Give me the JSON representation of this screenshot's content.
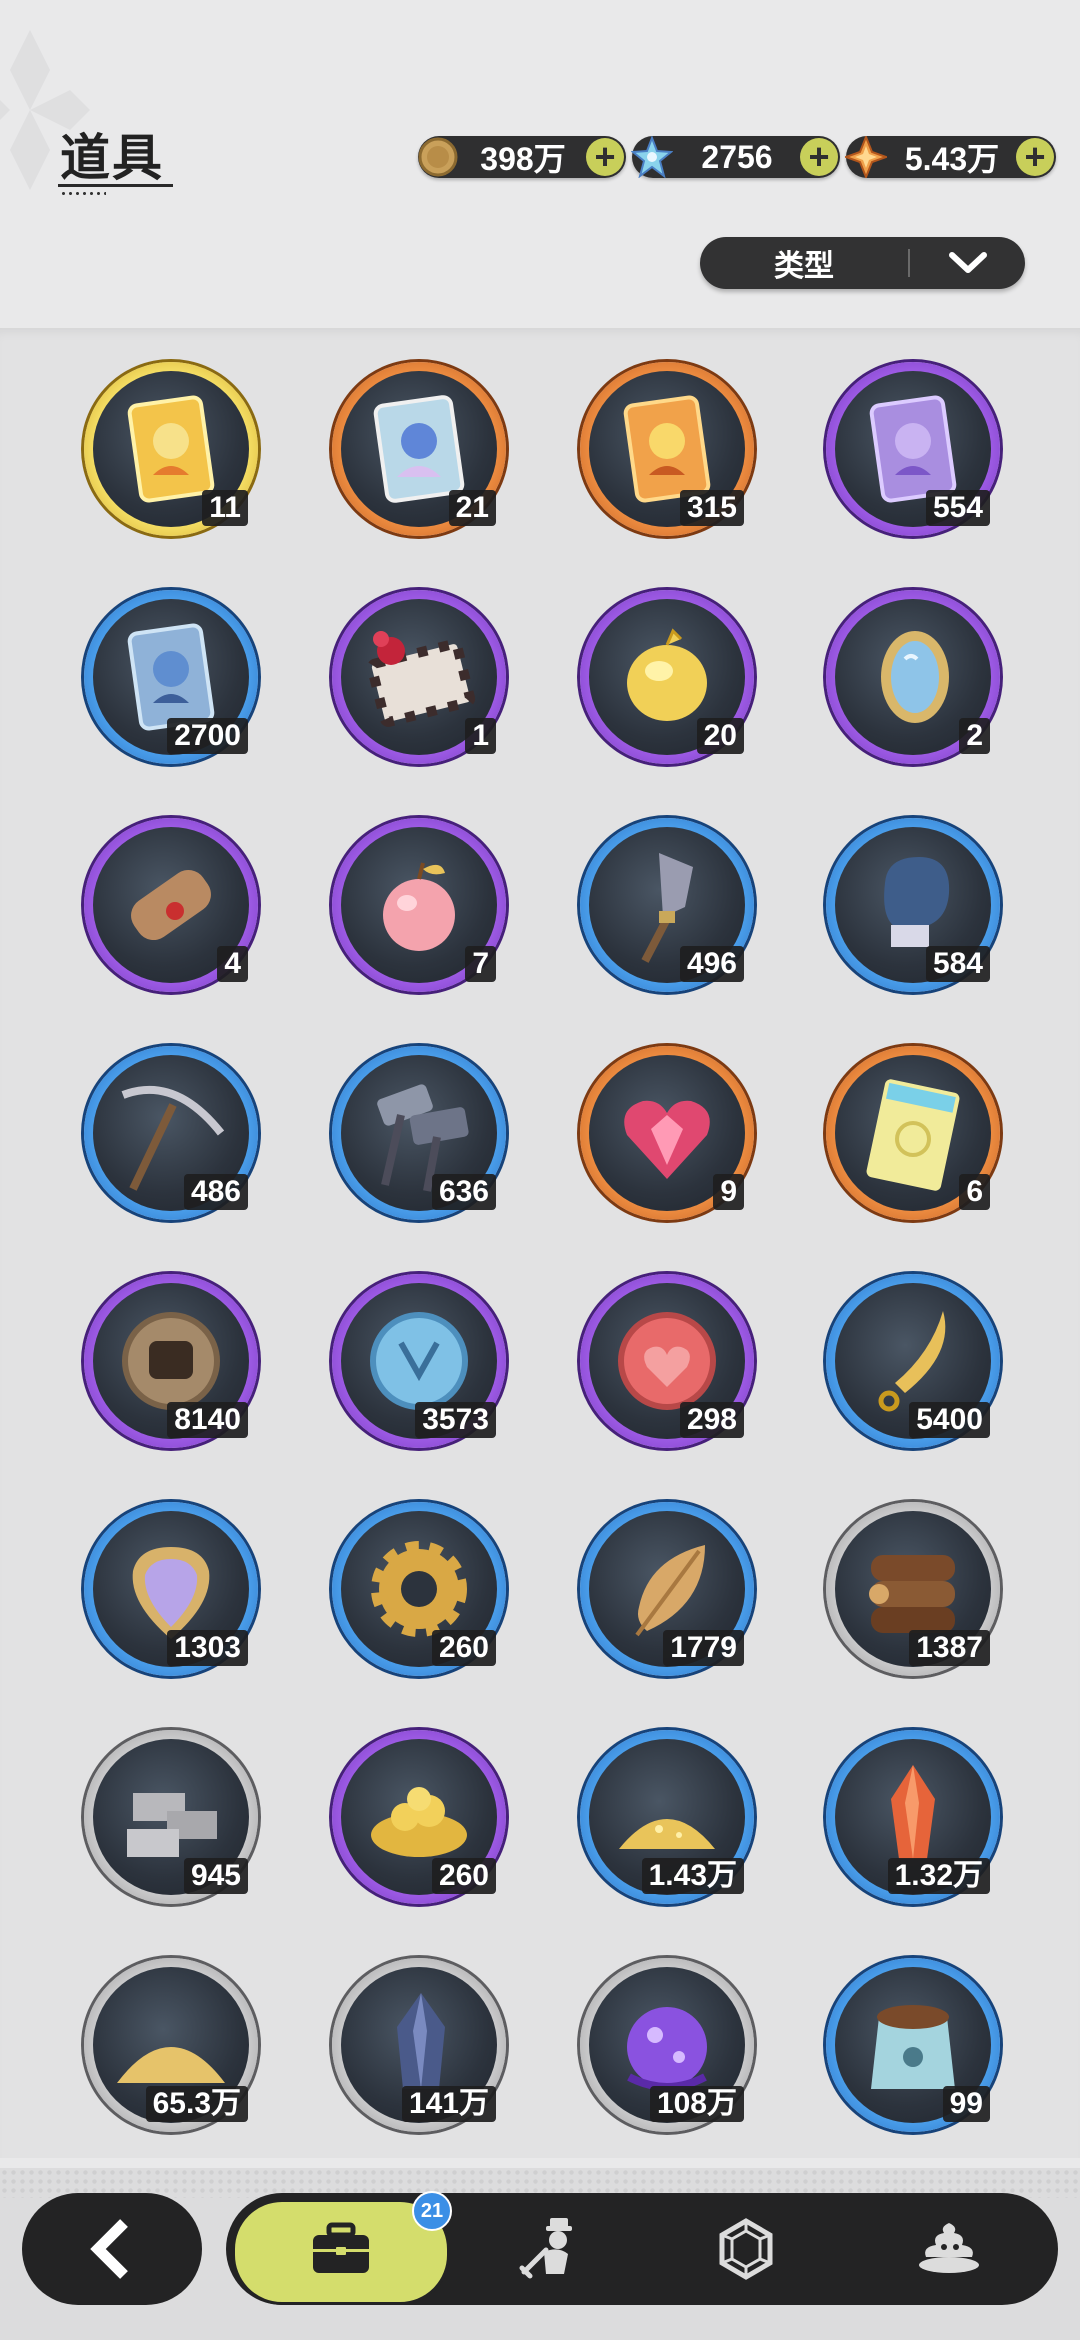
{
  "header": {
    "title": "道具",
    "currencies": [
      {
        "icon": "gold-coin-icon",
        "value": "398万"
      },
      {
        "icon": "star-crystal-icon",
        "value": "2756"
      },
      {
        "icon": "orange-gem-icon",
        "value": "5.43万"
      }
    ],
    "filter_label": "类型"
  },
  "items": [
    {
      "name": "golden-card-icon",
      "count": "11",
      "rarity": "gold"
    },
    {
      "name": "holo-card-icon",
      "count": "21",
      "rarity": "orange"
    },
    {
      "name": "orange-card-icon",
      "count": "315",
      "rarity": "orange"
    },
    {
      "name": "purple-card-icon",
      "count": "554",
      "rarity": "purple"
    },
    {
      "name": "blue-card-icon",
      "count": "2700",
      "rarity": "blue"
    },
    {
      "name": "gift-box-icon",
      "count": "1",
      "rarity": "purple"
    },
    {
      "name": "golden-egg-icon",
      "count": "20",
      "rarity": "purple"
    },
    {
      "name": "mirror-icon",
      "count": "2",
      "rarity": "purple"
    },
    {
      "name": "scroll-icon",
      "count": "4",
      "rarity": "purple"
    },
    {
      "name": "apple-icon",
      "count": "7",
      "rarity": "purple"
    },
    {
      "name": "shovel-icon",
      "count": "496",
      "rarity": "blue"
    },
    {
      "name": "boxing-glove-icon",
      "count": "584",
      "rarity": "blue"
    },
    {
      "name": "pickaxe-icon",
      "count": "486",
      "rarity": "blue"
    },
    {
      "name": "hammer-icon",
      "count": "636",
      "rarity": "blue"
    },
    {
      "name": "gem-heart-icon",
      "count": "9",
      "rarity": "orange"
    },
    {
      "name": "ticket-icon",
      "count": "6",
      "rarity": "orange"
    },
    {
      "name": "fist-medal-icon",
      "count": "8140",
      "rarity": "purple"
    },
    {
      "name": "blue-medal-icon",
      "count": "3573",
      "rarity": "purple"
    },
    {
      "name": "heart-medal-icon",
      "count": "298",
      "rarity": "purple"
    },
    {
      "name": "golden-blade-icon",
      "count": "5400",
      "rarity": "blue"
    },
    {
      "name": "scale-shield-icon",
      "count": "1303",
      "rarity": "blue"
    },
    {
      "name": "gear-icon",
      "count": "260",
      "rarity": "blue"
    },
    {
      "name": "leaf-icon",
      "count": "1779",
      "rarity": "blue"
    },
    {
      "name": "wood-logs-icon",
      "count": "1387",
      "rarity": "gray"
    },
    {
      "name": "stone-bricks-icon",
      "count": "945",
      "rarity": "gray"
    },
    {
      "name": "gold-nuggets-icon",
      "count": "260",
      "rarity": "purple"
    },
    {
      "name": "gold-pile-icon",
      "count": "1.43万",
      "rarity": "blue"
    },
    {
      "name": "red-crystal-icon",
      "count": "1.32万",
      "rarity": "blue"
    },
    {
      "name": "sand-pile-icon",
      "count": "65.3万",
      "rarity": "gray"
    },
    {
      "name": "dark-crystal-icon",
      "count": "141万",
      "rarity": "gray"
    },
    {
      "name": "purple-orb-icon",
      "count": "108万",
      "rarity": "gray"
    },
    {
      "name": "pet-food-bag-icon",
      "count": "99",
      "rarity": "blue"
    }
  ],
  "nav": {
    "badge_count": "21",
    "tabs": [
      {
        "icon": "briefcase-icon",
        "active": true
      },
      {
        "icon": "character-icon",
        "active": false
      },
      {
        "icon": "hexagon-gem-icon",
        "active": false
      },
      {
        "icon": "dessert-icon",
        "active": false
      }
    ]
  },
  "colors": {
    "gold": "#f2d24a",
    "orange": "#ee8a3c",
    "purple": "#9b55e0",
    "blue": "#4196e6",
    "gray": "#bdbdbf",
    "accent": "#d4dd6c",
    "dark": "#232324"
  }
}
